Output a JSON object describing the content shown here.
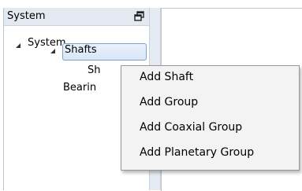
{
  "panel": {
    "title": "System",
    "pin_icon": "window-restore-icon"
  },
  "tree": {
    "root": "System",
    "shafts": "Shafts",
    "shaft_child": "Sh",
    "bearings": "Bearin"
  },
  "context_menu": {
    "items": [
      "Add Shaft",
      "Add Group",
      "Add Coaxial Group",
      "Add Planetary Group"
    ]
  },
  "colors": {
    "header_bg": "#e4e9f1",
    "selection_border": "#7da2ce",
    "menu_bg": "#f3f3f3"
  }
}
